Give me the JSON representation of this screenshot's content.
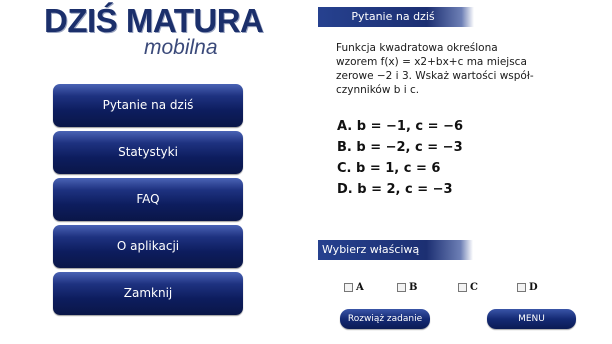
{
  "logo": {
    "title": "DZIŚ MATURA",
    "subtitle": "mobilna"
  },
  "menu": {
    "items": [
      {
        "label": "Pytanie na dziś"
      },
      {
        "label": "Statystyki"
      },
      {
        "label": "FAQ"
      },
      {
        "label": "O aplikacji"
      },
      {
        "label": "Zamknij"
      }
    ]
  },
  "question_panel": {
    "header": "Pytanie na dziś",
    "text_lines": [
      "Funkcja kwadratowa określona",
      "wzorem f(x) = x2+bx+c ma miejsca",
      "zerowe −2 i 3. Wskaż wartości współ-",
      "czynników b i c."
    ],
    "answers": [
      "A. b = −1, c = −6",
      "B. b = −2, c = −3",
      "C. b = 1, c = 6",
      "D. b = 2, c = −3"
    ]
  },
  "answer_panel": {
    "header": "Wybierz właściwą odpowiedź",
    "choices": [
      {
        "label": "A",
        "checked": false
      },
      {
        "label": "B",
        "checked": false
      },
      {
        "label": "C",
        "checked": false
      },
      {
        "label": "D",
        "checked": false
      }
    ]
  },
  "buttons": {
    "solve": "Rozwiąż zadanie",
    "menu": "MENU"
  },
  "colors": {
    "primary": "#1e3280",
    "header": "#26418f",
    "logo": "#1b2f6b"
  }
}
